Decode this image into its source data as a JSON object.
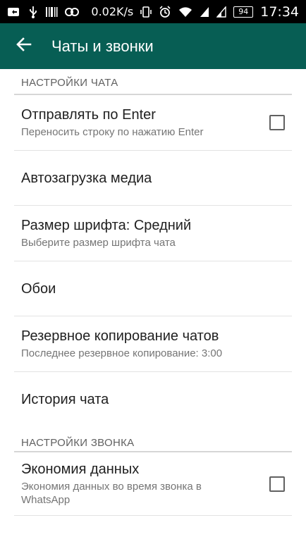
{
  "status_bar": {
    "icons_left": [
      "bluetooth-share-icon",
      "usb-icon",
      "barcode-icon",
      "game-icon"
    ],
    "network_speed": "0.02K/s",
    "icons_right": [
      "vibrate-icon",
      "alarm-icon",
      "wifi-icon",
      "signal-icon",
      "signal-2-icon"
    ],
    "battery": "94",
    "time": "17:34"
  },
  "app_bar": {
    "back_icon": "arrow-left-icon",
    "title": "Чаты и звонки",
    "color": "#075e54"
  },
  "sections": {
    "chat": {
      "header": "НАСТРОЙКИ ЧАТА",
      "items": [
        {
          "title": "Отправлять по Enter",
          "summary": "Переносить строку по нажатию Enter",
          "checked": false
        },
        {
          "title": "Автозагрузка медиа"
        },
        {
          "title": "Размер шрифта: Средний",
          "summary": "Выберите размер шрифта чата"
        },
        {
          "title": "Обои"
        },
        {
          "title": "Резервное копирование чатов",
          "summary": "Последнее резервное копирование: 3:00"
        },
        {
          "title": "История чата"
        }
      ]
    },
    "call": {
      "header": "НАСТРОЙКИ ЗВОНКА",
      "items": [
        {
          "title": "Экономия данных",
          "summary": "Экономия данных во время звонка в WhatsApp",
          "checked": false
        }
      ]
    }
  }
}
